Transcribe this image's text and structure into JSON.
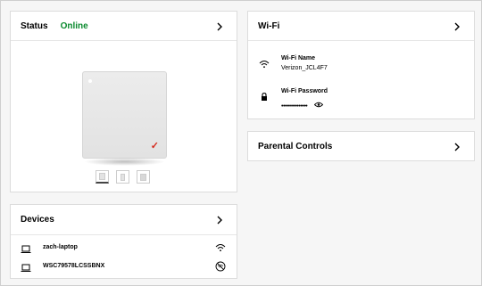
{
  "status": {
    "title": "Status",
    "state": "Online",
    "state_color": "#0a8a2e",
    "router_check": "✓",
    "router_check_color": "#d52b1e",
    "thumbnails": [
      {
        "selected": true
      },
      {
        "selected": false
      },
      {
        "selected": false
      }
    ]
  },
  "wifi": {
    "title": "Wi-Fi",
    "name_label": "Wi-Fi Name",
    "name_value": "Verizon_JCL4F7",
    "password_label": "Wi-Fi Password",
    "password_masked": "•••••••••••••••"
  },
  "parental": {
    "title": "Parental Controls"
  },
  "devices": {
    "title": "Devices",
    "items": [
      {
        "name": "zach-laptop",
        "icon": "laptop-icon",
        "status_icon": "wifi-icon"
      },
      {
        "name": "WSC79578LCSSBNX",
        "icon": "laptop-icon",
        "status_icon": "wifi-off-icon"
      }
    ]
  }
}
